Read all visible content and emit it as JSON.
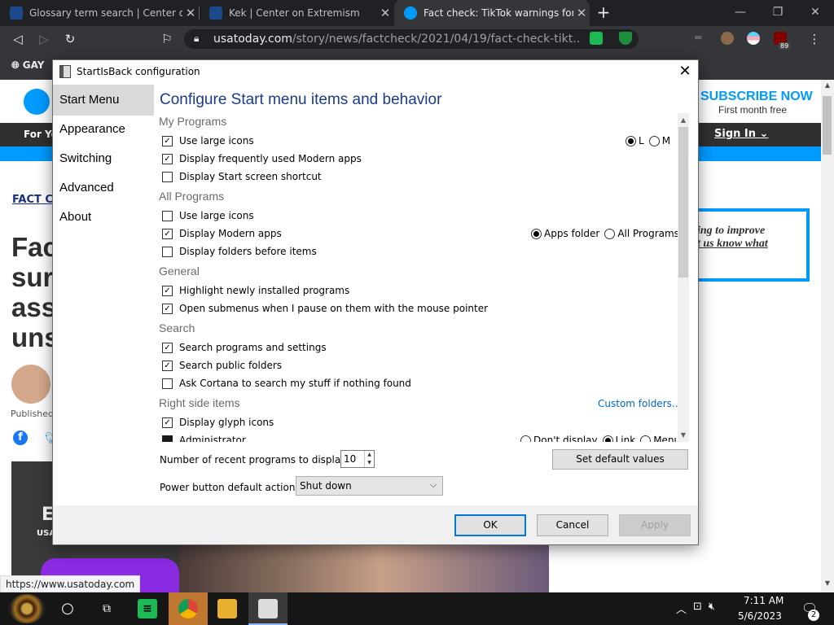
{
  "browser": {
    "tabs": [
      {
        "title": "Glossary term search | Center o",
        "favicon_color": "#1a4a8c",
        "active": false
      },
      {
        "title": "Kek | Center on Extremism",
        "favicon_color": "#1a4a8c",
        "active": false
      },
      {
        "title": "Fact check: TikTok warnings for",
        "favicon_color": "#009bff",
        "active": true
      }
    ],
    "url_domain": "usatoday.com",
    "url_path": "/story/news/factcheck/2021/04/19/fact-check-tikt...",
    "bookmark_label": "GAY",
    "ext_badge": "89"
  },
  "webpage": {
    "subscribe": "SUBSCRIBE NOW",
    "first_month": "First month free",
    "nav_for_you": "For Yo",
    "sign_in": "Sign In",
    "fact_check_label": "FACT C",
    "headline_lines": [
      "Fac",
      "sur",
      "ass",
      "uns"
    ],
    "published": "Published",
    "ad_line1": "ing to improve",
    "ad_line2": "t us know what",
    "video_letter": "E",
    "video_small": "USA",
    "status_url": "https://www.usatoday.com",
    "brand_color": "#009bff"
  },
  "dialog": {
    "title": "StartIsBack configuration",
    "heading": "Configure Start menu items and behavior",
    "nav": [
      "Start Menu",
      "Appearance",
      "Switching",
      "Advanced",
      "About"
    ],
    "selected_nav": "Start Menu",
    "sections": {
      "my_programs": {
        "title": "My Programs",
        "items": [
          {
            "label": "Use large icons",
            "checked": true
          },
          {
            "label": "Display frequently used Modern apps",
            "checked": true
          },
          {
            "label": "Display Start screen shortcut",
            "checked": false
          }
        ],
        "icon_size_options": [
          {
            "label": "L",
            "selected": true
          },
          {
            "label": "M",
            "selected": false
          }
        ]
      },
      "all_programs": {
        "title": "All Programs",
        "items": [
          {
            "label": "Use large icons",
            "checked": false
          },
          {
            "label": "Display Modern apps",
            "checked": true
          },
          {
            "label": "Display folders before items",
            "checked": false
          }
        ],
        "modern_apps_options": [
          {
            "label": "Apps folder",
            "selected": true
          },
          {
            "label": "All Programs",
            "selected": false
          }
        ]
      },
      "general": {
        "title": "General",
        "items": [
          {
            "label": "Highlight newly installed programs",
            "checked": true
          },
          {
            "label": "Open submenus when I pause on them with the mouse pointer",
            "checked": true
          }
        ]
      },
      "search": {
        "title": "Search",
        "items": [
          {
            "label": "Search programs and settings",
            "checked": true
          },
          {
            "label": "Search public folders",
            "checked": true
          },
          {
            "label": "Ask Cortana to search my stuff if nothing found",
            "checked": false
          }
        ]
      },
      "right_side": {
        "title": "Right side items",
        "custom_folders": "Custom folders...",
        "items": [
          {
            "label": "Display glyph icons",
            "checked": true
          },
          {
            "label": "Administrator",
            "checked": "filled"
          }
        ],
        "admin_options": [
          {
            "label": "Don't display",
            "selected": false
          },
          {
            "label": "Link",
            "selected": true
          },
          {
            "label": "Menu",
            "selected": false
          }
        ]
      }
    },
    "recent_label": "Number of recent programs to display:",
    "recent_value": "10",
    "set_defaults": "Set default values",
    "power_label": "Power button default action:",
    "power_value": "Shut down",
    "buttons": {
      "ok": "OK",
      "cancel": "Cancel",
      "apply": "Apply"
    }
  },
  "taskbar": {
    "time": "7:11 AM",
    "date": "5/6/2023",
    "notifications": "2"
  }
}
